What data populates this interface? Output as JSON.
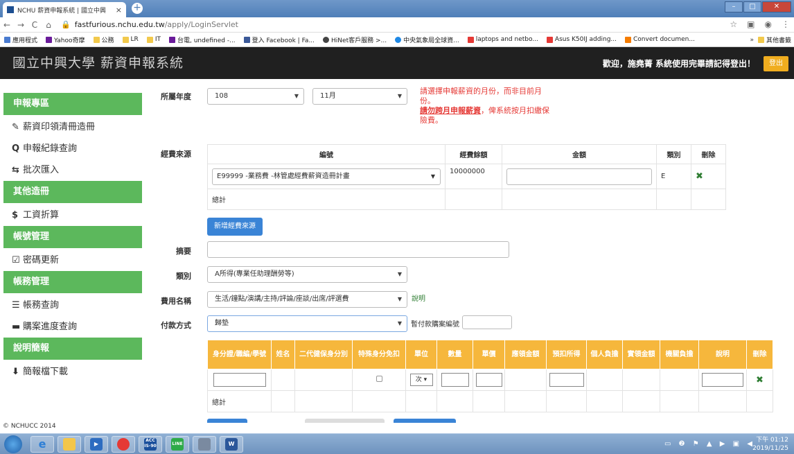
{
  "browser": {
    "tab_title": "NCHU 薪資申報系統 | 國立中興",
    "tab_close": "×",
    "new_tab": "+",
    "url_host": "fastfurious.nchu.edu.tw",
    "url_path": "/apply/LoginServlet",
    "bookmarks": [
      "應用程式",
      "Yahoo奇摩",
      "公務",
      "LR",
      "IT",
      "台電, undefined -...",
      "登入 Facebook | Fa...",
      "HiNet客戶服務 >...",
      "中央氣象局全球資...",
      "laptops and netbo...",
      "Asus K50IJ adding...",
      "Convert documen..."
    ],
    "bookmark_more": "»",
    "bookmark_other": "其他書籤"
  },
  "site": {
    "logo": "國立中興大學 薪資申報系統",
    "welcome": "歡迎，施堯菁 系統使用完畢請記得登出！",
    "logout": "登出"
  },
  "sidebar": {
    "sections": [
      {
        "title": "申報專區",
        "items": [
          {
            "icon": "✎",
            "label": "薪資印領清冊造冊"
          },
          {
            "icon": "Q",
            "label": "申報紀錄查詢"
          },
          {
            "icon": "⇆",
            "label": "批次匯入"
          }
        ]
      },
      {
        "title": "其他造冊",
        "items": [
          {
            "icon": "$",
            "label": "工資折算"
          }
        ]
      },
      {
        "title": "帳號管理",
        "items": [
          {
            "icon": "☑",
            "label": "密碼更新"
          }
        ]
      },
      {
        "title": "帳務管理",
        "items": [
          {
            "icon": "☰",
            "label": "帳務查詢"
          },
          {
            "icon": "▬",
            "label": "購案進度查詢"
          }
        ]
      },
      {
        "title": "說明簡報",
        "items": [
          {
            "icon": "⬇",
            "label": "簡報檔下載"
          }
        ]
      }
    ],
    "copyright": "© NCHUCC 2014"
  },
  "form": {
    "year_label": "所屬年度",
    "year_value": "108",
    "month_value": "11月",
    "note_line1": "請選擇申報薪資的月份，而非目前月",
    "note_line2": "份。",
    "note_bold": "請勿跨月申報薪資",
    "note_line3": "，俾系統按月扣繳保",
    "note_line4": "險費。",
    "fund_label": "經費來源",
    "fund_headers": [
      "編號",
      "經費餘額",
      "金額",
      "類別",
      "刪除"
    ],
    "fund_row": {
      "code": "E99999 -業務費 -林管處經費薪資造冊計畫",
      "balance": "10000000",
      "amount": "",
      "category": "E",
      "delete": "✖"
    },
    "fund_total": "總計",
    "add_fund_button": "新增經費來源",
    "summary_label": "摘要",
    "category_label": "類別",
    "category_value": "A所得(專業任助理酬勞等)",
    "fee_label": "費用名稱",
    "fee_value": "生活/鐘點/演講/主持/評論/座談/出席/評選費",
    "fee_help": "說明",
    "pay_label": "付款方式",
    "pay_value": "歸墊",
    "temp_pay_label": "暫付款購案編號"
  },
  "pay_table": {
    "headers": [
      "身分證/職編/學號",
      "姓名",
      "二代健保身分別",
      "特殊身分免扣",
      "單位",
      "數量",
      "單價",
      "應領金額",
      "預扣所得",
      "個人負擔",
      "實領金額",
      "機關負擔",
      "說明",
      "刪除"
    ],
    "unit_value": "次",
    "delete": "✖",
    "total": "總計"
  },
  "taskbar": {
    "apps": [
      "ACC IS-90",
      "W"
    ],
    "time": "下午 01:12",
    "date": "2019/11/25"
  }
}
